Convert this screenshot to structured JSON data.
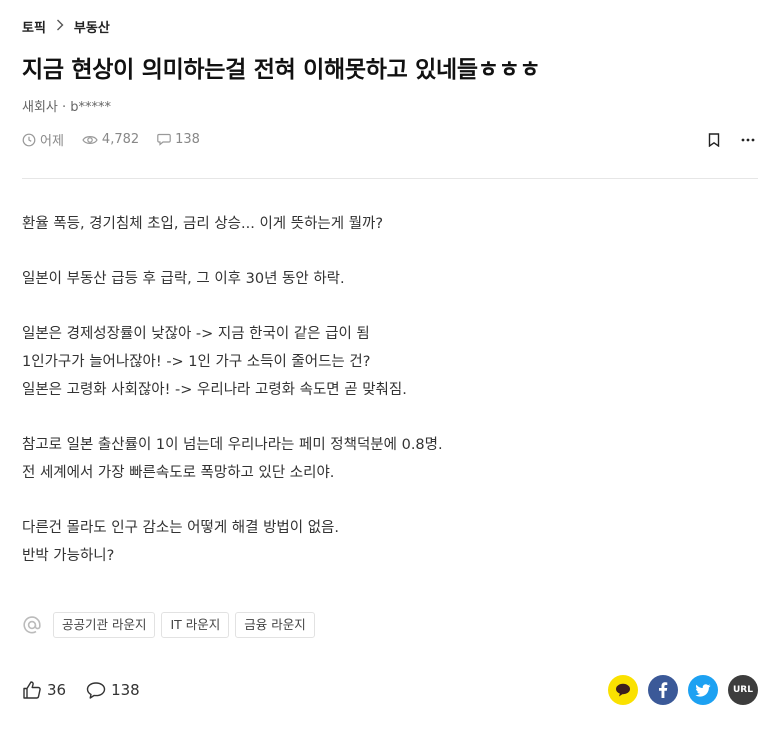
{
  "breadcrumb": {
    "root": "토픽",
    "current": "부동산"
  },
  "post": {
    "title": "지금 현상이 의미하는걸 전혀 이해못하고 있네들ㅎㅎㅎ",
    "author": "새회사 · b*****",
    "time": "어제",
    "views": "4,782",
    "comments": "138"
  },
  "body_paragraphs": [
    [
      "환율 폭등, 경기침체 초입, 금리 상승... 이게 뜻하는게 뭘까?"
    ],
    [
      "일본이 부동산 급등 후 급락, 그 이후 30년 동안 하락."
    ],
    [
      "일본은 경제성장률이 낮잖아 -> 지금 한국이 같은 급이 됨",
      "1인가구가 늘어나잖아! -> 1인 가구 소득이 줄어드는 건?",
      "일본은 고령화 사회잖아! -> 우리나라 고령화 속도면 곧 맞춰짐."
    ],
    [
      "참고로 일본 출산률이 1이 넘는데 우리나라는 페미 정책덕분에 0.8명.",
      "전 세계에서 가장 빠른속도로 폭망하고 있단 소리야."
    ],
    [
      "다른건 몰라도 인구 감소는 어떻게 해결 방법이 없음.",
      "반박 가능하니?"
    ]
  ],
  "topics": [
    "공공기관 라운지",
    "IT 라운지",
    "금융 라운지"
  ],
  "footer": {
    "likes": "36",
    "comments": "138"
  },
  "share": {
    "kakao_color": "#FAE100",
    "facebook_color": "#3B5998",
    "twitter_color": "#1DA1F2",
    "url_color": "#3D3D3D",
    "url_label": "URL"
  },
  "icons": [
    "chevron-right-icon",
    "clock-icon",
    "eye-icon",
    "comment-icon",
    "bookmark-icon",
    "more-icon",
    "at-icon",
    "thumbs-up-icon",
    "kakao-icon",
    "facebook-icon",
    "twitter-icon",
    "url-icon"
  ]
}
